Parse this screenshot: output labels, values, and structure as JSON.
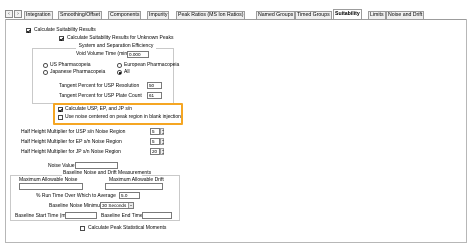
{
  "tabs": [
    "Integration",
    "Smoothing/Offset",
    "Components",
    "Impurity",
    "Peak Ratios (MS Ion Ratios)",
    "Named Groups",
    "Timed Groups",
    "Suitability",
    "Limits",
    "Noise and Drift"
  ],
  "active_tab": "Suitability",
  "suitability": {
    "calculate_results": {
      "label": "Calculate Suitability Results",
      "checked": true
    },
    "calculate_unknown": {
      "label": "Calculate Suitability Results for Unknown Peaks",
      "checked": true
    },
    "separation": {
      "title": "System and Separation Efficiency",
      "void_volume_label": "Void Volume Time (min)",
      "void_volume_value": "0.000",
      "pharmacopeia": [
        {
          "label": "US Pharmacopeia",
          "selected": false
        },
        {
          "label": "European Pharmacopeia",
          "selected": false
        },
        {
          "label": "Japanese Pharmacopeia",
          "selected": false
        },
        {
          "label": "All",
          "selected": true
        }
      ],
      "tangent_resolution_label": "Tangent Percent for USP Resolution",
      "tangent_resolution_value": "50",
      "tangent_plate_label": "Tangent Percent for USP Plate Count",
      "tangent_plate_value": "61"
    },
    "calc_sn": {
      "label": "Calculate USP, EP, and JP s/n",
      "checked": true
    },
    "noise_centered": {
      "label": "Use noise centered on peak region in blank injection",
      "checked": false
    },
    "half_height": [
      {
        "label": "Half Height Multiplier for USP s/n Noise Region",
        "value": "5"
      },
      {
        "label": "Half Height Multiplier for EP s/n Noise Region",
        "value": "5"
      },
      {
        "label": "Half Height Multiplier for JP s/n Noise Region",
        "value": "20"
      }
    ],
    "noise_value_label": "Noise Value for s/n",
    "noise_value": "",
    "baseline": {
      "title": "Baseline Noise and Drift Measurements",
      "max_noise_label": "Maximum Allowable Noise",
      "max_noise_value": "",
      "max_drift_label": "Maximum Allowable Drift",
      "max_drift_value": "",
      "run_time_label": "% Run Time Over Which to Average",
      "run_time_value": "5.0",
      "minimum_label": "Baseline Noise Minimum",
      "minimum_value": "30 Seconds",
      "start_label": "Baseline Start Time (min)",
      "start_value": "",
      "end_label": "Baseline End Time (min)",
      "end_value": ""
    },
    "peak_stats": {
      "label": "Calculate Peak Statistical Moments",
      "checked": false
    }
  },
  "colors": {
    "highlight": "#f5a623",
    "border": "#9c9c9c"
  }
}
